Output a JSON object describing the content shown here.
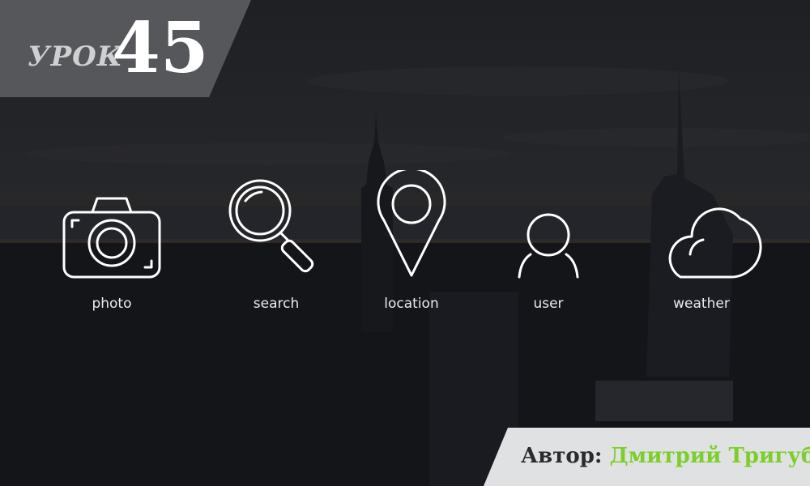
{
  "colors": {
    "background": "#1b1d22",
    "lesson_badge": "#56575a",
    "author_badge": "#e0e1e3",
    "author_name": "#7ccf2a",
    "icon_stroke": "#ffffff"
  },
  "lesson": {
    "word": "УРОК",
    "number": "45"
  },
  "icons": [
    {
      "icon": "camera-icon",
      "label": "photo"
    },
    {
      "icon": "search-icon",
      "label": "search"
    },
    {
      "icon": "location-pin-icon",
      "label": "location"
    },
    {
      "icon": "user-icon",
      "label": "user"
    },
    {
      "icon": "cloud-icon",
      "label": "weather"
    }
  ],
  "author": {
    "label": "Автор:",
    "name": "Дмитрий Тригуб"
  }
}
